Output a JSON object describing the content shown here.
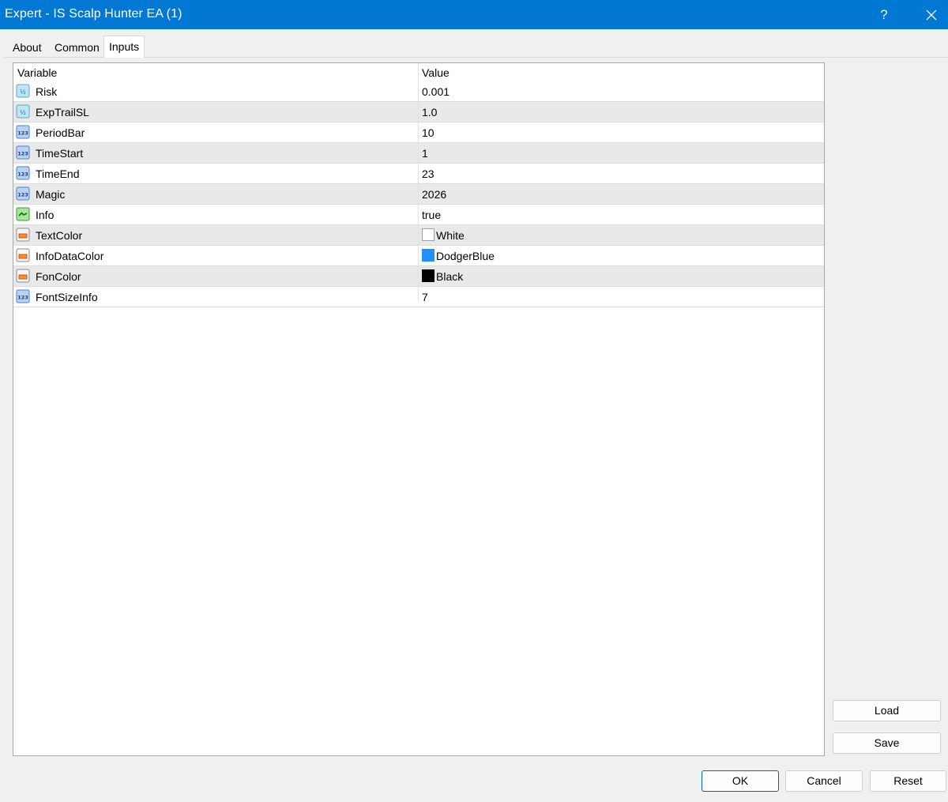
{
  "window": {
    "title": "Expert - IS Scalp Hunter EA (1)",
    "help_label": "?",
    "accent_color": "#0078d4"
  },
  "tabs": [
    {
      "label": "About"
    },
    {
      "label": "Common"
    },
    {
      "label": "Inputs",
      "active": true
    }
  ],
  "grid": {
    "columns": {
      "variable": "Variable",
      "value": "Value"
    },
    "rows": [
      {
        "name": "Risk",
        "value": "0.001",
        "icon": "double-type-icon"
      },
      {
        "name": "ExpTrailSL",
        "value": "1.0",
        "icon": "double-type-icon"
      },
      {
        "name": "PeriodBar",
        "value": "10",
        "icon": "integer-type-icon"
      },
      {
        "name": "TimeStart",
        "value": "1",
        "icon": "integer-type-icon"
      },
      {
        "name": "TimeEnd",
        "value": "23",
        "icon": "integer-type-icon"
      },
      {
        "name": "Magic",
        "value": "2026",
        "icon": "integer-type-icon"
      },
      {
        "name": "Info",
        "value": "true",
        "icon": "bool-type-icon"
      },
      {
        "name": "TextColor",
        "value": "White",
        "icon": "color-type-icon",
        "swatch": "#ffffff"
      },
      {
        "name": "InfoDataColor",
        "value": "DodgerBlue",
        "icon": "color-type-icon",
        "swatch": "#1e90ff"
      },
      {
        "name": "FonColor",
        "value": "Black",
        "icon": "color-type-icon",
        "swatch": "#000000"
      },
      {
        "name": "FontSizeInfo",
        "value": "7",
        "icon": "integer-type-icon"
      }
    ]
  },
  "buttons": {
    "load": "Load",
    "save": "Save",
    "ok": "OK",
    "cancel": "Cancel",
    "reset": "Reset"
  }
}
